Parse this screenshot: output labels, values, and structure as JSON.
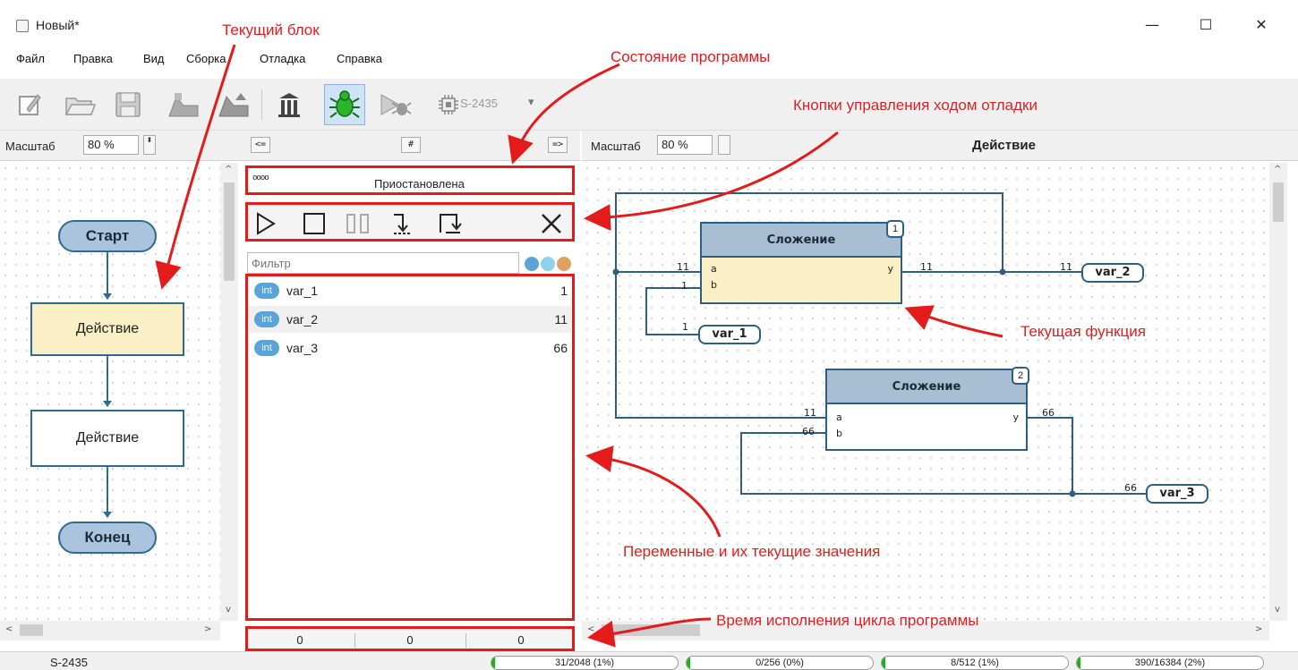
{
  "window": {
    "title": "Новый*",
    "minimize_glyph": "—",
    "maximize_glyph": "☐",
    "close_glyph": "✕"
  },
  "menu": [
    "Файл",
    "Правка",
    "Вид",
    "Сборка",
    "Отладка",
    "Справка"
  ],
  "toolbar": {
    "icons": [
      "new-icon",
      "open-icon",
      "save-icon",
      "build-icon",
      "upload-icon",
      "library-icon",
      "debug-icon",
      "debug-run-icon",
      "device-icon"
    ],
    "device": "S-2435",
    "dropdown_glyph": "▾"
  },
  "left_panel": {
    "scale_label": "Масштаб",
    "scale_value": "80 %",
    "spin_glyph": "⬍",
    "blocks": [
      "Старт",
      "Действие",
      "Действие",
      "Конец"
    ],
    "scroll_up": "^",
    "scroll_down": "v",
    "scroll_left": "<",
    "scroll_right": ">"
  },
  "middle_panel": {
    "nav_prev": "<=",
    "nav_hash": "#",
    "nav_next": "=>",
    "state_icon": "oooo",
    "state_text": "Приостановлена",
    "debug_buttons": [
      "run-icon",
      "stop-icon",
      "pause-icon",
      "step-into-icon",
      "step-over-icon",
      "close-icon"
    ],
    "filter_placeholder": "Фильтр",
    "filter_colors": [
      "#5aa4d6",
      "#8ed1ea",
      "#e0a060"
    ],
    "variables": [
      {
        "type": "int",
        "name": "var_1",
        "value": "1"
      },
      {
        "type": "int",
        "name": "var_2",
        "value": "11"
      },
      {
        "type": "int",
        "name": "var_3",
        "value": "66"
      }
    ],
    "cycle_times": [
      "0",
      "0",
      "0"
    ]
  },
  "right_panel": {
    "scale_label": "Масштаб",
    "scale_value": "80 %",
    "title": "Действие",
    "blocks": [
      {
        "num": "1",
        "title": "Сложение",
        "in_a": "a",
        "in_b": "b",
        "out": "y"
      },
      {
        "num": "2",
        "title": "Сложение",
        "in_a": "a",
        "in_b": "b",
        "out": "y"
      }
    ],
    "wire_labels": [
      "11",
      "1",
      "11",
      "11",
      "1",
      "11",
      "66",
      "66",
      "66"
    ],
    "var_nodes": [
      "var_2",
      "var_1",
      "var_3"
    ]
  },
  "annotations": {
    "current_block": "Текущий блок",
    "program_state": "Состояние программы",
    "debug_controls": "Кнопки управления ходом отладки",
    "current_function": "Текущая функция",
    "variables": "Переменные и их текущие значения",
    "cycle_time": "Время исполнения цикла программы"
  },
  "status_bar": {
    "device": "S-2435",
    "resources": [
      {
        "text": "31/2048 (1%)",
        "fill": 0.01
      },
      {
        "text": "0/256 (0%)",
        "fill": 0.0
      },
      {
        "text": "8/512 (1%)",
        "fill": 0.01
      },
      {
        "text": "390/16384 (2%)",
        "fill": 0.02
      }
    ]
  },
  "colors": {
    "annotation": "#e41b1b",
    "block_border": "#2e6b8f",
    "block_head": "#a8bfd3",
    "current_block_fill": "#fbefc6",
    "progress": "#1ab01a"
  }
}
